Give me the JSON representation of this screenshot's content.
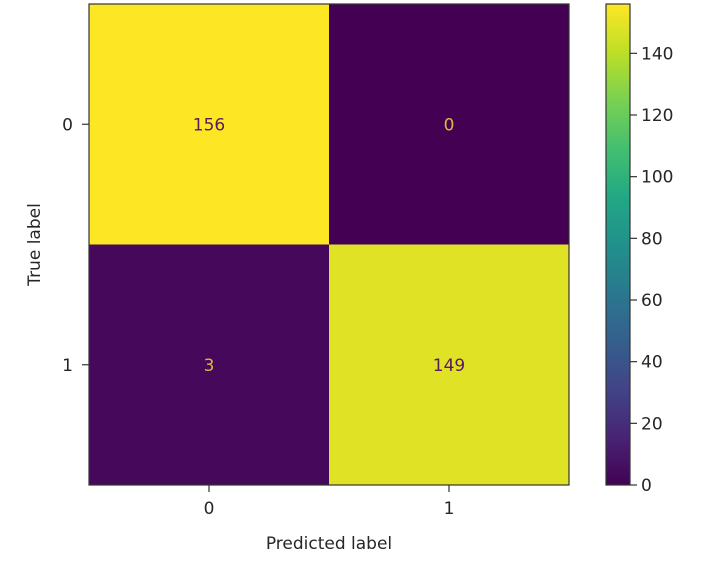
{
  "chart_data": {
    "type": "heatmap",
    "title": "",
    "xlabel": "Predicted label",
    "ylabel": "True label",
    "x_categories": [
      "0",
      "1"
    ],
    "y_categories": [
      "0",
      "1"
    ],
    "matrix": [
      [
        156,
        0
      ],
      [
        3,
        149
      ]
    ],
    "colormap": "viridis",
    "colorbar": {
      "range": [
        0,
        156
      ],
      "ticks": [
        0,
        20,
        40,
        60,
        80,
        100,
        120,
        140
      ],
      "tick_labels": [
        "0",
        "20",
        "40",
        "60",
        "80",
        "100",
        "120",
        "140"
      ]
    },
    "text_colors": {
      "on_dark": "#e0b73a",
      "on_light": "#5a1a5e"
    },
    "grid": false,
    "legend": "colorbar-right"
  }
}
